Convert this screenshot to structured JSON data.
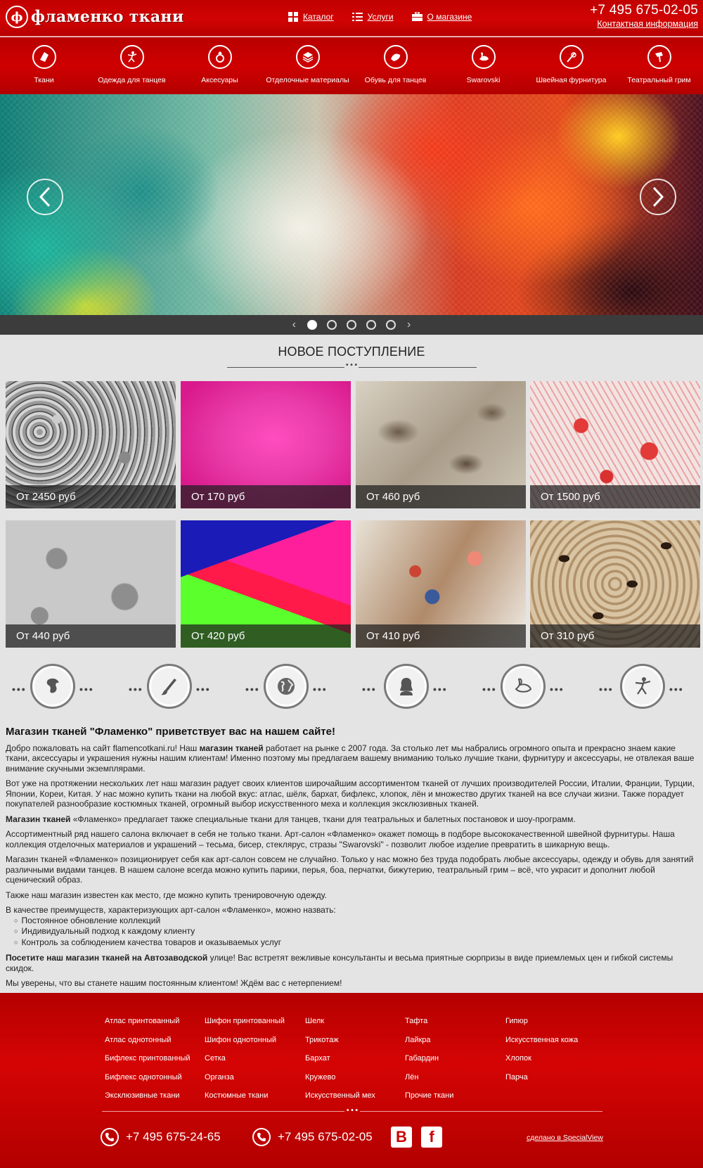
{
  "header": {
    "logo_text": "фламенко ткани",
    "nav": [
      {
        "label": "Каталог",
        "icon": "grid-icon"
      },
      {
        "label": "Услуги",
        "icon": "list-icon"
      },
      {
        "label": "О магазине",
        "icon": "briefcase-icon"
      }
    ],
    "phone": "+7 495 675-02-05",
    "contact_link": "Контактная информация"
  },
  "categories": [
    {
      "label": "Ткани",
      "icon": "fabric-icon"
    },
    {
      "label": "Одежда для танцев",
      "icon": "dancer-icon"
    },
    {
      "label": "Аксесуары",
      "icon": "ring-icon"
    },
    {
      "label": "Отделочные материалы",
      "icon": "layers-icon"
    },
    {
      "label": "Обувь для танцев",
      "icon": "shoe-icon"
    },
    {
      "label": "Swarovski",
      "icon": "swan-icon"
    },
    {
      "label": "Швейная фурнитура",
      "icon": "needle-icon"
    },
    {
      "label": "Театральный грим",
      "icon": "brush-icon"
    }
  ],
  "slider": {
    "dots": 5,
    "active": 0
  },
  "new_arrivals": {
    "title": "НОВОЕ ПОСТУПЛЕНИЕ",
    "products": [
      {
        "price": "От 2450 руб"
      },
      {
        "price": "От 170 руб"
      },
      {
        "price": "От 460 руб"
      },
      {
        "price": "От 1500 руб"
      },
      {
        "price": "От 440 руб"
      },
      {
        "price": "От 420 руб"
      },
      {
        "price": "От 410 руб"
      },
      {
        "price": "От 310 руб"
      }
    ]
  },
  "feature_icons": [
    "mask-icon",
    "brush-icon",
    "globe-icon",
    "woman-icon",
    "swan-icon",
    "dancer-icon"
  ],
  "article": {
    "title": "Магазин тканей \"Фламенко\" приветствует вас на нашем сайте!",
    "p1_a": "Добро пожаловать на сайт flamencotkani.ru! Наш ",
    "p1_b": "магазин тканей",
    "p1_c": " работает на рынке с 2007 года. За столько лет мы набрались огромного опыта и прекрасно знаем какие ткани, аксессуары и украшения нужны нашим клиентам! Именно поэтому мы предлагаем вашему вниманию только лучшие ткани, фурнитуру и аксессуары, не отвлекая ваше внимание скучными экземплярами.",
    "p2": "Вот уже на протяжении нескольких лет наш магазин радует своих клиентов широчайшим ассортиментом тканей от лучших производителей России, Италии, Франции, Турции, Японии, Кореи, Китая. У нас можно купить ткани на любой вкус: атлас, шёлк, бархат, бифлекс, хлопок, лён и множество других тканей на все случаи жизни. Также порадует покупателей разнообразие костюмных тканей, огромный выбор искусственного меха и коллекция эксклюзивных тканей.",
    "p3_a": "Магазин тканей",
    "p3_b": " «Фламенко» предлагает также специальные ткани для танцев, ткани для театральных и балетных постановок и шоу-программ.",
    "p4": "Ассортиментный ряд нашего салона включает в себя не только ткани. Арт-салон «Фламенко» окажет помощь в подборе высококачественной швейной фурнитуры. Наша коллекция отделочных материалов и украшений – тесьма, бисер, стеклярус, стразы \"Swarovski\" - позволит любое изделие превратить в шикарную вещь.",
    "p5": "Магазин тканей «Фламенко» позиционирует себя как арт-салон совсем не случайно. Только у нас можно без труда подобрать любые аксессуары, одежду и обувь для занятий различными видами танцев. В нашем салоне всегда можно купить парики, перья, боа, перчатки, бижутерию, театральный грим – всё, что украсит и дополнит любой сценический образ.",
    "p6": "Также наш магазин известен как место, где можно купить тренировочную одежду.",
    "p7": "В качестве преимуществ, характеризующих арт-салон «Фламенко», можно назвать:",
    "list": [
      "Постоянное обновление коллекций",
      "Индивидуальный подход к каждому клиенту",
      "Контроль за соблюдением качества товаров и оказываемых услуг"
    ],
    "p8_a": "Посетите наш магазин тканей на Автозаводской",
    "p8_b": " улице! Вас встретят вежливые консультанты и весьма приятные сюрпризы в виде приемлемых цен и гибкой системы скидок.",
    "p9": "Мы уверены, что вы станете нашим постоянным клиентом! Ждём вас с нетерпением!"
  },
  "footer": {
    "columns": [
      [
        "Атлас принтованный",
        "Атлас однотонный",
        "Бифлекс принтованный",
        "Бифлекс однотонный",
        "Эксклюзивные ткани"
      ],
      [
        "Шифон принтованный",
        "Шифон однотонный",
        "Сетка",
        "Органза",
        "Костюмные ткани"
      ],
      [
        "Шелк",
        "Трикотаж",
        "Бархат",
        "Кружево",
        "Искусственный мех"
      ],
      [
        "Тафта",
        "Лайкра",
        "Габардин",
        "Лён",
        "Прочие ткани"
      ],
      [
        "Гипюр",
        "Искусственная кожа",
        "Хлопок",
        "Парча"
      ]
    ],
    "phone1": "+7 495 675-24-65",
    "phone2": "+7 495 675-02-05",
    "vk": "В",
    "fb": "f",
    "made_by": "сделано в SpecialView"
  }
}
